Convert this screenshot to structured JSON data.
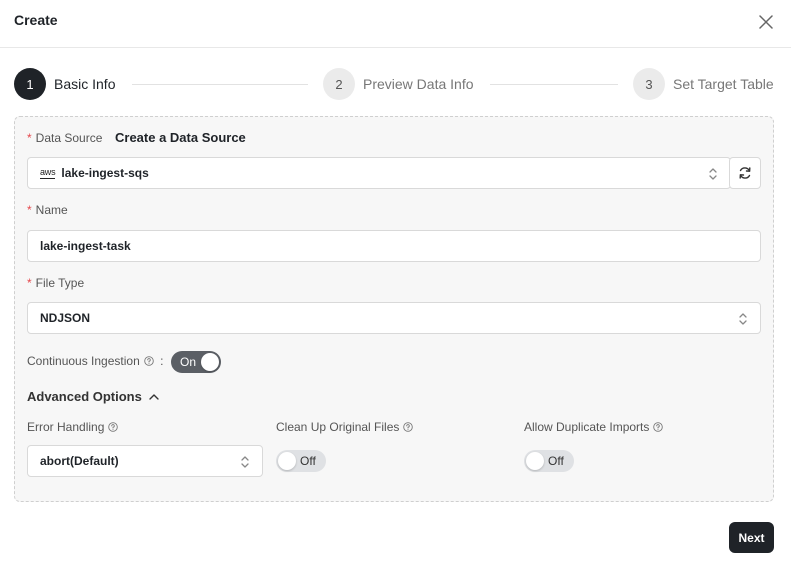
{
  "modal": {
    "title": "Create",
    "next_label": "Next"
  },
  "steps": [
    {
      "number": "1",
      "label": "Basic Info",
      "state": "active"
    },
    {
      "number": "2",
      "label": "Preview Data Info",
      "state": "inactive"
    },
    {
      "number": "3",
      "label": "Set Target Table",
      "state": "inactive"
    }
  ],
  "form": {
    "data_source": {
      "label": "Data Source",
      "create_link": "Create a Data Source",
      "provider_logo": "aws",
      "value": "lake-ingest-sqs"
    },
    "name": {
      "label": "Name",
      "value": "lake-ingest-task"
    },
    "file_type": {
      "label": "File Type",
      "value": "NDJSON"
    },
    "continuous_ingestion": {
      "label": "Continuous Ingestion",
      "suffix": ":",
      "toggle_text": "On",
      "enabled": true
    },
    "advanced_options": {
      "label": "Advanced Options",
      "expanded": true
    },
    "error_handling": {
      "label": "Error Handling",
      "value": "abort(Default)"
    },
    "clean_up_original_files": {
      "label": "Clean Up Original Files",
      "toggle_text": "Off",
      "enabled": false
    },
    "allow_duplicate_imports": {
      "label": "Allow Duplicate Imports",
      "toggle_text": "Off",
      "enabled": false
    }
  },
  "colors": {
    "primary": "#1f2328",
    "required": "#e5484d",
    "toggle_on": "#5b5f65",
    "toggle_off": "#dfe1e4"
  }
}
